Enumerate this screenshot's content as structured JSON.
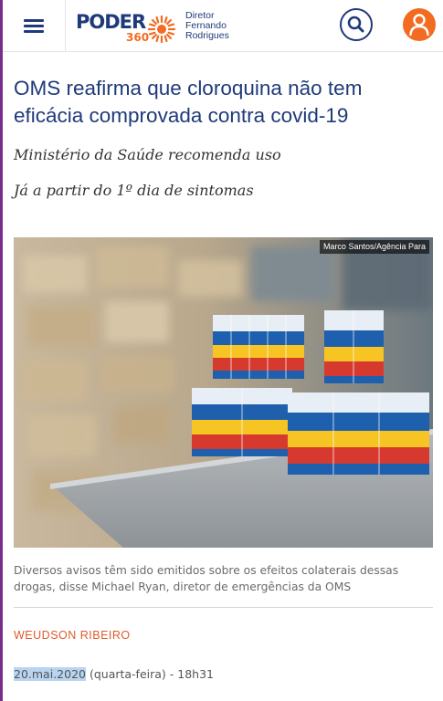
{
  "header": {
    "logo_word": "PODER",
    "logo_num": "360",
    "director_label": "Diretor",
    "director_first": "Fernando",
    "director_last": "Rodrigues"
  },
  "article": {
    "title": "OMS reafirma que cloroquina não tem eficácia comprovada contra covid-19",
    "subtitle_1": "Ministério da Saúde recomenda uso",
    "subtitle_2": "Já a partir do 1º dia de sintomas",
    "photo_credit": "Marco Santos/Agência Para",
    "caption": "Diversos avisos têm sido emitidos sobre os efeitos colaterais dessas drogas, disse Michael Ryan, diretor de emergências da OMS",
    "author": "WEUDSON RIBEIRO",
    "date": "20.mai.2020",
    "date_rest": " (quarta-feira) - 18h31"
  },
  "colors": {
    "brand_blue": "#1f3a7a",
    "brand_orange": "#f26b21",
    "left_bar": "#7b2d8e",
    "author": "#e05a2b"
  },
  "icons": [
    "menu-icon",
    "sun-logo-icon",
    "search-icon",
    "user-icon"
  ]
}
